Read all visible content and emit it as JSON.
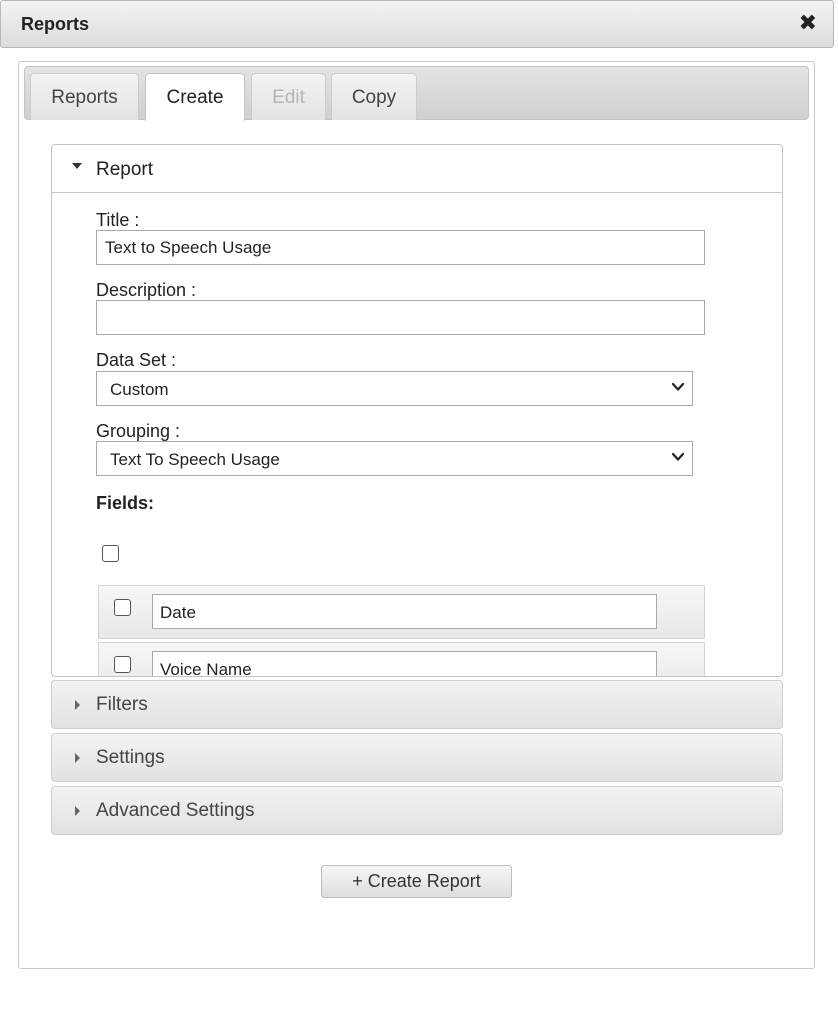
{
  "window": {
    "title": "Reports",
    "close_glyph": "✖"
  },
  "tabs": [
    {
      "label": "Reports",
      "state": "normal"
    },
    {
      "label": "Create",
      "state": "active"
    },
    {
      "label": "Edit",
      "state": "disabled"
    },
    {
      "label": "Copy",
      "state": "normal"
    }
  ],
  "report_section": {
    "label": "Report",
    "title_label": "Title :",
    "title_value": "Text to Speech Usage",
    "description_label": "Description :",
    "description_value": "",
    "dataset_label": "Data Set :",
    "dataset_value": "Custom",
    "grouping_label": "Grouping :",
    "grouping_value": "Text To Speech Usage",
    "fields_label": "Fields:",
    "fields": [
      {
        "name": "Date",
        "checked": false
      },
      {
        "name": "Voice Name",
        "checked": false
      }
    ]
  },
  "collapsed_sections": [
    {
      "label": "Filters"
    },
    {
      "label": "Settings"
    },
    {
      "label": "Advanced Settings"
    }
  ],
  "create_button": {
    "label": "+ Create Report"
  }
}
